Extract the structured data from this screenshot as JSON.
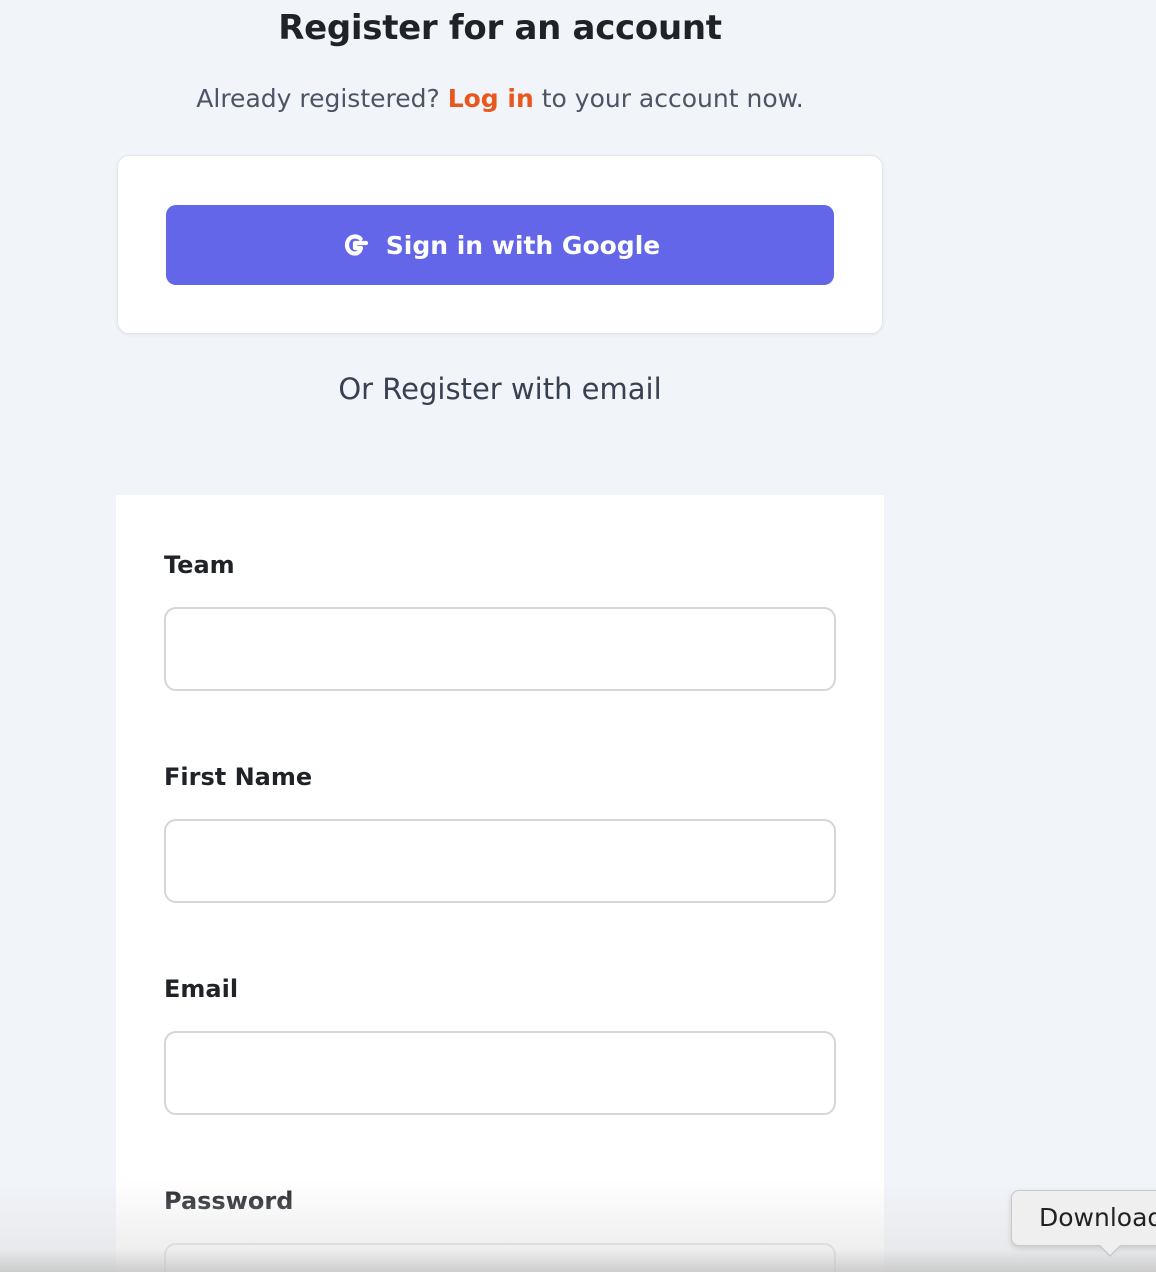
{
  "header": {
    "title": "Register for an account",
    "subtitle_before": "Already registered? ",
    "login_link": "Log in",
    "subtitle_after": " to your account now."
  },
  "oauth": {
    "google_button_label": "Sign in with Google",
    "icon": "google-g-icon"
  },
  "divider_text": "Or Register with email",
  "form": {
    "fields": [
      {
        "label": "Team",
        "value": "",
        "placeholder": ""
      },
      {
        "label": "First Name",
        "value": "",
        "placeholder": ""
      },
      {
        "label": "Email",
        "value": "",
        "placeholder": ""
      },
      {
        "label": "Password",
        "value": "",
        "placeholder": ""
      }
    ]
  },
  "overlay": {
    "download_label": "Download"
  },
  "colors": {
    "background": "#f1f4f9",
    "accent_button": "#6366e9",
    "link": "#e8571e"
  }
}
